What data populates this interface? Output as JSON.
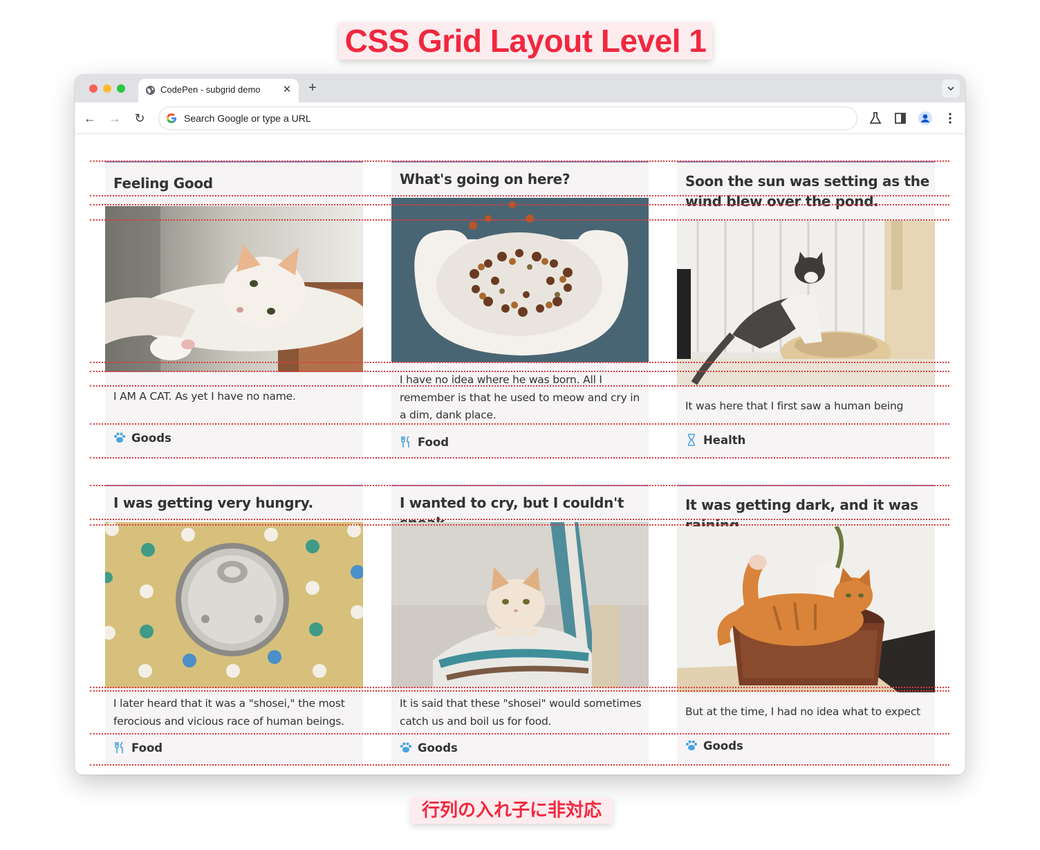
{
  "banner": {
    "title": "CSS Grid Layout Level 1",
    "caption": "行列の入れ子に非対応"
  },
  "browser": {
    "tab_title": "CodePen - subgrid demo",
    "tab_close": "✕",
    "new_tab": "+",
    "omnibox_placeholder": "Search Google or type a URL",
    "back": "←",
    "forward": "→",
    "reload": "↻"
  },
  "cards": [
    {
      "title": "Feeling Good",
      "body": "I AM A CAT. As yet I have no name.",
      "tag": "Goods",
      "tag_icon": "paw-icon",
      "image": "cat-on-box"
    },
    {
      "title": "What's going on here?",
      "body": "I have no idea where he was born. All I remember is that he used to meow and cry in a dim, dank place.",
      "tag": "Food",
      "tag_icon": "fork-knife-icon",
      "image": "cat-food-bowl"
    },
    {
      "title": "Soon the sun was setting as the wind blew over the pond.",
      "body": "It was here that I first saw a human being",
      "tag": "Health",
      "tag_icon": "hourglass-icon",
      "image": "cat-in-bed"
    },
    {
      "title": "I was getting very hungry.",
      "body": "I later heard that it was a \"shosei,\" the most ferocious and vicious race of human beings.",
      "tag": "Food",
      "tag_icon": "fork-knife-icon",
      "image": "can-on-polka-dots"
    },
    {
      "title": "I wanted to cry, but I couldn't speak",
      "body": "It is said that these \"shosei\" would sometimes catch us and boil us for food.",
      "tag": "Goods",
      "tag_icon": "paw-icon",
      "image": "cat-in-bag"
    },
    {
      "title": "It was getting dark, and it was raining",
      "body": "But at the time, I had no idea what to expect",
      "tag": "Goods",
      "tag_icon": "paw-icon",
      "image": "cat-in-basket"
    }
  ],
  "colors": {
    "accent": "#f0283f",
    "card_top_border": "#8f7cc2",
    "gridline": "#e0393c",
    "card_bg": "#f6f4f5",
    "tag_icon": "#4aa3e0"
  }
}
